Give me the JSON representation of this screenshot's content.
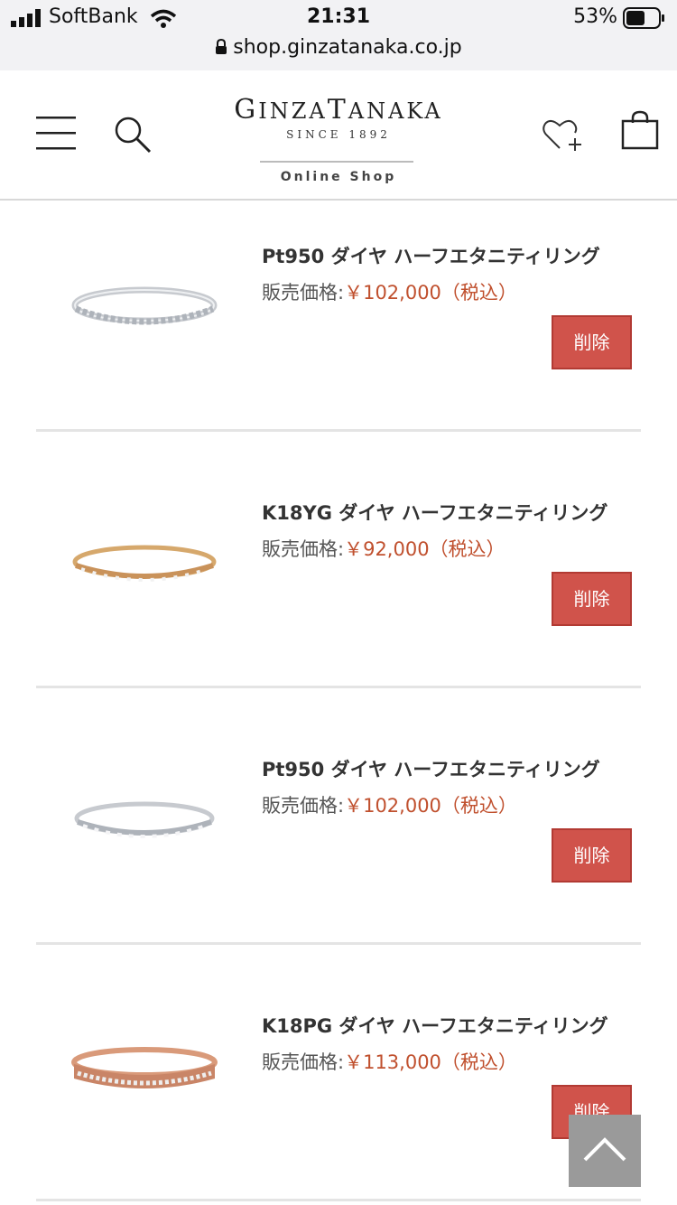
{
  "status_bar": {
    "carrier": "SoftBank",
    "time": "21:31",
    "battery": "53%",
    "url": "shop.ginzatanaka.co.jp"
  },
  "header": {
    "logo_g": "G",
    "logo_inza": "INZA",
    "logo_t": "T",
    "logo_anaka": "ANAKA",
    "since": "SINCE 1892",
    "online_shop": "Online Shop"
  },
  "items": [
    {
      "name": "Pt950 ダイヤ ハーフエタニティリング",
      "price_label": "販売価格:",
      "price": "￥102,000（税込）",
      "delete_label": "削除",
      "metal": "platinum"
    },
    {
      "name": "K18YG ダイヤ ハーフエタニティリング",
      "price_label": "販売価格:",
      "price": "￥92,000（税込）",
      "delete_label": "削除",
      "metal": "yellow-gold"
    },
    {
      "name": "Pt950 ダイヤ ハーフエタニティリング",
      "price_label": "販売価格:",
      "price": "￥102,000（税込）",
      "delete_label": "削除",
      "metal": "platinum"
    },
    {
      "name": "K18PG ダイヤ ハーフエタニティリング",
      "price_label": "販売価格:",
      "price": "￥113,000（税込）",
      "delete_label": "削除",
      "metal": "pink-gold"
    }
  ],
  "colors": {
    "delete_button": "#d0534b",
    "price": "#c0502e",
    "scroll_top": "#9a9a9a"
  },
  "icons": [
    "signal-icon",
    "wifi-icon",
    "battery-icon",
    "lock-icon",
    "menu-icon",
    "search-icon",
    "favorite-heart-icon",
    "cart-bag-icon",
    "ring-image",
    "chevron-up-icon"
  ]
}
